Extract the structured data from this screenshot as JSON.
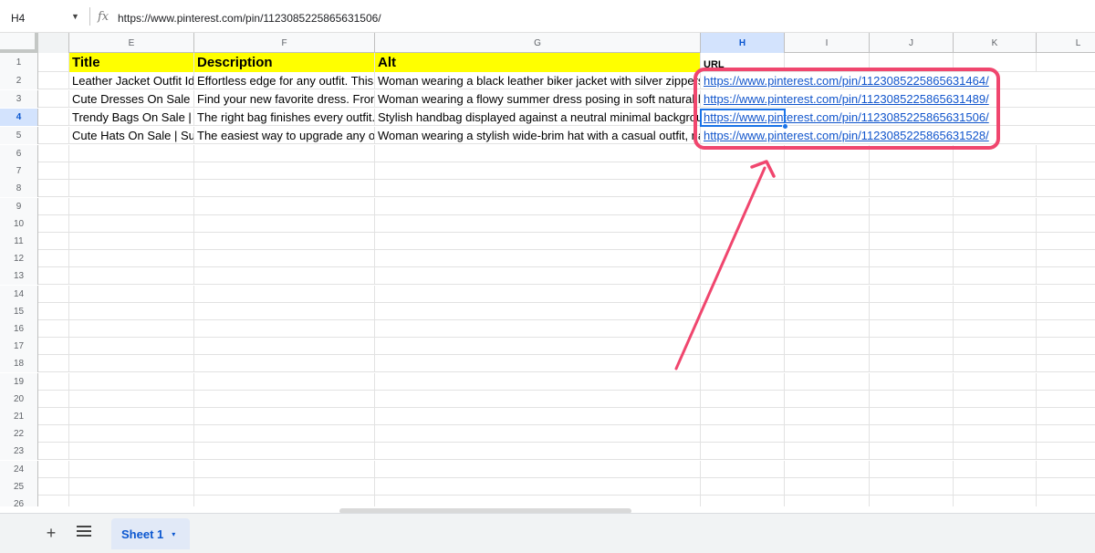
{
  "formula_bar": {
    "name_box": "H4",
    "fx_label": "fx",
    "formula": "https://www.pinterest.com/pin/1123085225865631506/"
  },
  "columns": [
    "E",
    "F",
    "G",
    "H",
    "I",
    "J",
    "K",
    "L"
  ],
  "selected_column": "H",
  "row_numbers": [
    "1",
    "2",
    "3",
    "4",
    "5",
    "6",
    "7",
    "8",
    "9",
    "10",
    "11",
    "12",
    "13",
    "14",
    "15",
    "16",
    "17",
    "18",
    "19",
    "20",
    "21",
    "22",
    "23",
    "24",
    "25",
    "26"
  ],
  "selected_row": "4",
  "header_row": {
    "title": "Title",
    "description": "Description",
    "alt": "Alt",
    "url": "URL"
  },
  "rows": [
    {
      "title": "Leather Jacket Outfit Ide",
      "description": "Effortless edge for any outfit. This le",
      "alt": "Woman wearing a black leather biker jacket with silver zippers o",
      "url": "https://www.pinterest.com/pin/1123085225865631464/"
    },
    {
      "title": "Cute Dresses On Sale | (",
      "description": "Find your new favorite dress. From c",
      "alt": "Woman wearing a flowy summer dress posing in soft natural ligh",
      "url": "https://www.pinterest.com/pin/1123085225865631489/"
    },
    {
      "title": "Trendy Bags On Sale | H",
      "description": "The right bag finishes every outfit. D",
      "alt": "Stylish handbag displayed against a neutral minimal background",
      "url": "https://www.pinterest.com/pin/1123085225865631506/"
    },
    {
      "title": "Cute Hats On Sale | Sum",
      "description": "The easiest way to upgrade any outf",
      "alt": "Woman wearing a stylish wide-brim hat with a casual outfit, natu",
      "url": "https://www.pinterest.com/pin/1123085225865631528/"
    }
  ],
  "colors": {
    "header_fill": "#ffff00",
    "link": "#1155cc",
    "selection": "#1a73e8",
    "annotation": "#f0466e"
  },
  "bottom_bar": {
    "add_sheet_icon": "+",
    "all_sheets_icon": "menu-icon",
    "sheet_tab_label": "Sheet 1",
    "sheet_tab_arrow": "▾"
  }
}
